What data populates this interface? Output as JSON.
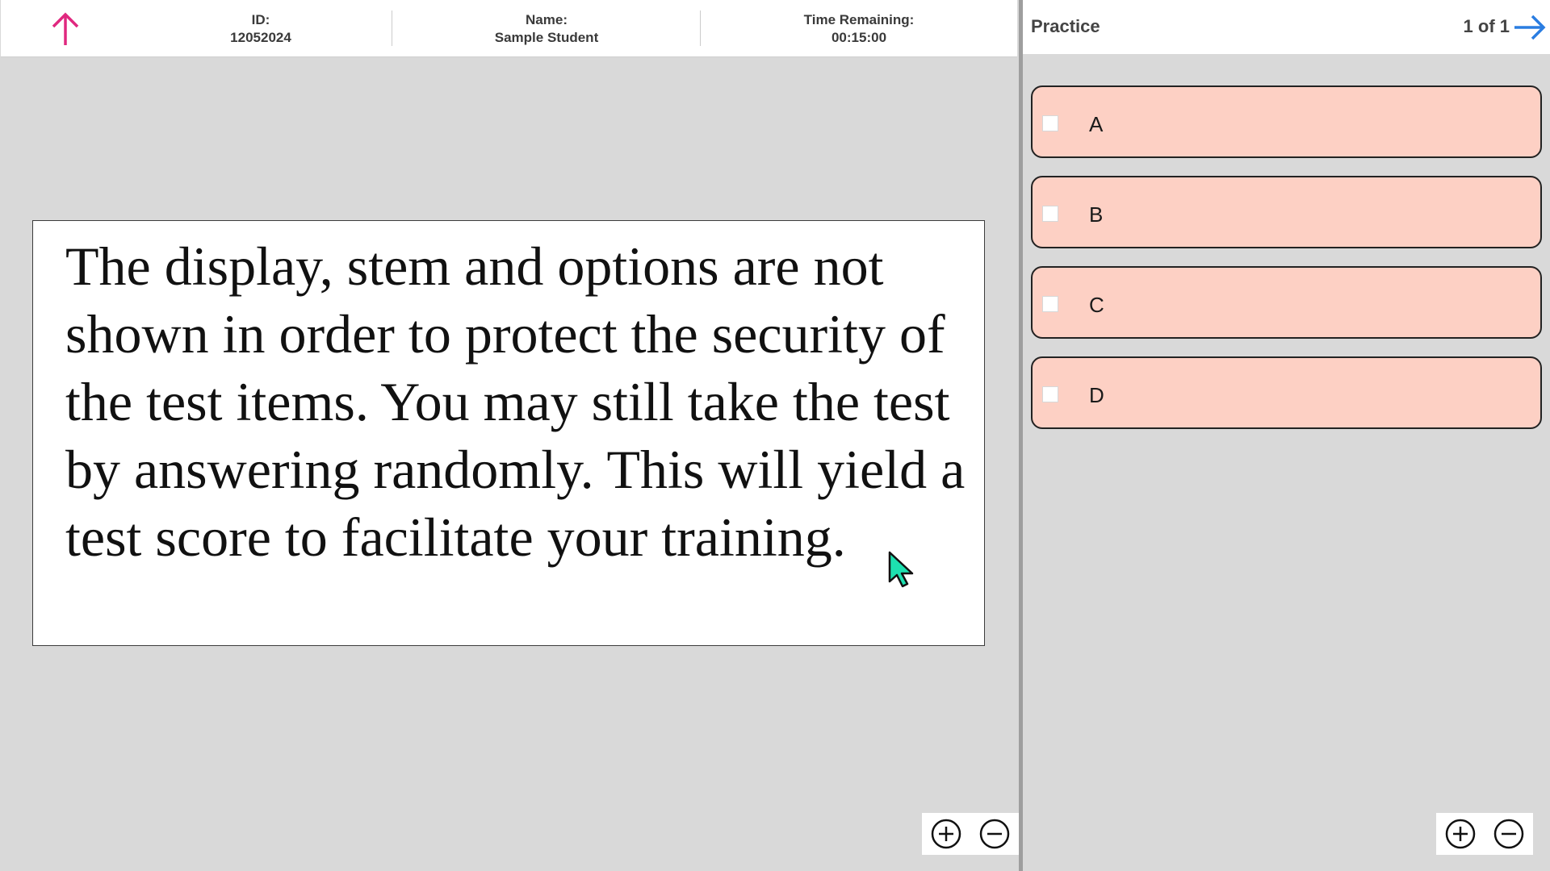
{
  "header": {
    "id_label": "ID:",
    "id_value": "12052024",
    "name_label": "Name:",
    "name_value": "Sample Student",
    "time_label": "Time Remaining:",
    "time_value": "00:15:00"
  },
  "stem": {
    "text": "The display, stem and options are not shown in order to protect the security of the test items. You may still take the test by answering randomly. This will yield a test score to facilitate your training."
  },
  "answer_panel": {
    "title": "Practice",
    "counter": "1 of 1",
    "options": [
      {
        "label": "A"
      },
      {
        "label": "B"
      },
      {
        "label": "C"
      },
      {
        "label": "D"
      }
    ]
  },
  "colors": {
    "up_arrow": "#e0287f",
    "next_arrow": "#2a7de1",
    "option_bg": "#fdd0c4",
    "page_bg": "#d9d9d9",
    "cursor": "#1de0b0"
  },
  "icons": [
    "arrow-up-icon",
    "arrow-right-icon",
    "zoom-in-icon",
    "zoom-out-icon",
    "mouse-cursor-icon"
  ]
}
